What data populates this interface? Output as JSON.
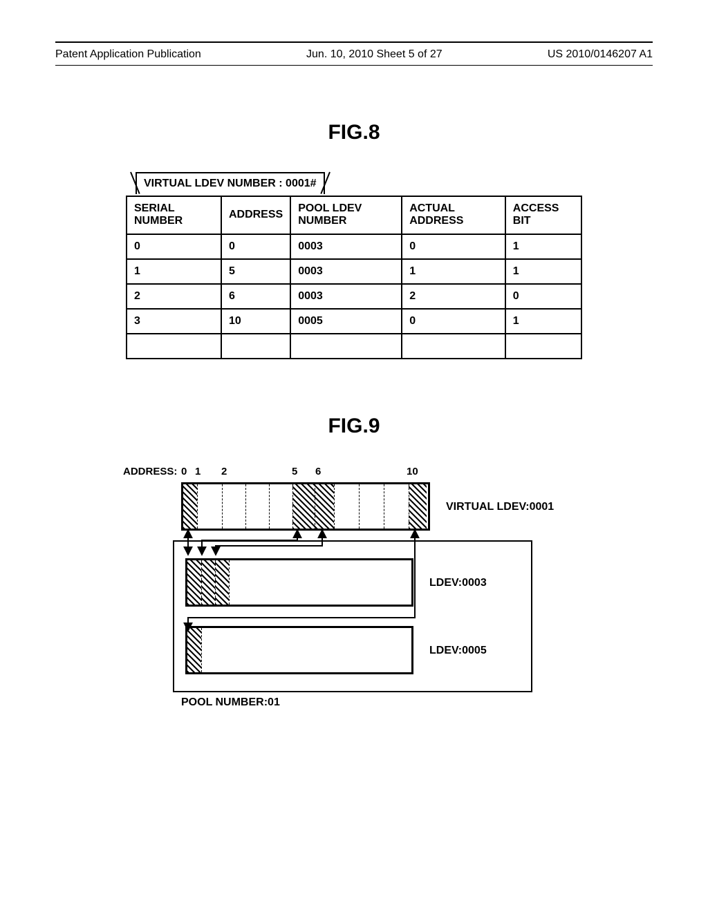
{
  "header": {
    "left": "Patent Application Publication",
    "center": "Jun. 10, 2010  Sheet 5 of 27",
    "right": "US 2010/0146207 A1"
  },
  "fig8": {
    "title": "FIG.8",
    "tab_label": "VIRTUAL LDEV NUMBER : 0001#",
    "columns": [
      "SERIAL NUMBER",
      "ADDRESS",
      "POOL LDEV NUMBER",
      "ACTUAL ADDRESS",
      "ACCESS BIT"
    ],
    "rows": [
      {
        "serial": "0",
        "address": "0",
        "pool_ldev": "0003",
        "actual": "0",
        "access": "1"
      },
      {
        "serial": "1",
        "address": "5",
        "pool_ldev": "0003",
        "actual": "1",
        "access": "1"
      },
      {
        "serial": "2",
        "address": "6",
        "pool_ldev": "0003",
        "actual": "2",
        "access": "0"
      },
      {
        "serial": "3",
        "address": "10",
        "pool_ldev": "0005",
        "actual": "0",
        "access": "1"
      }
    ]
  },
  "fig9": {
    "title": "FIG.9",
    "address_label": "ADDRESS:",
    "address_ticks": [
      "0",
      "1",
      "2",
      "5",
      "6",
      "10"
    ],
    "virtual_ldev_label": "VIRTUAL LDEV:0001",
    "ldev_a_label": "LDEV:0003",
    "ldev_b_label": "LDEV:0005",
    "pool_label": "POOL NUMBER:01"
  }
}
